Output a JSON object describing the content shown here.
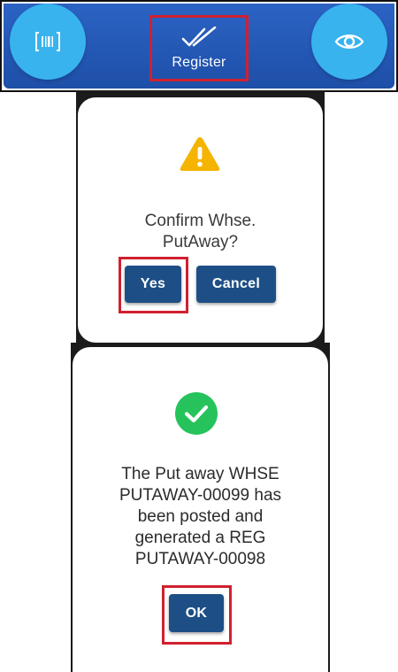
{
  "action_bar": {
    "left_icon": "barcode-scan-icon",
    "register_icon": "double-check-icon",
    "register_label": "Register",
    "right_icon": "eye-icon",
    "colors": {
      "bar": "#1e4fa8",
      "fab": "#38b3ee",
      "highlight": "#d02030"
    }
  },
  "confirm_dialog": {
    "icon": "warning-icon",
    "message_lines": [
      "Confirm Whse.",
      "PutAway?"
    ],
    "yes_label": "Yes",
    "cancel_label": "Cancel",
    "colors": {
      "warning": "#f5b400",
      "button": "#1d4f86"
    }
  },
  "success_dialog": {
    "icon": "check-circle-icon",
    "message_lines": [
      "The Put away WHSE",
      "PUTAWAY-00099 has",
      "been posted and",
      "generated a REG",
      "PUTAWAY-00098"
    ],
    "ok_label": "OK",
    "colors": {
      "success": "#26c35c",
      "button": "#1d4f86"
    }
  }
}
